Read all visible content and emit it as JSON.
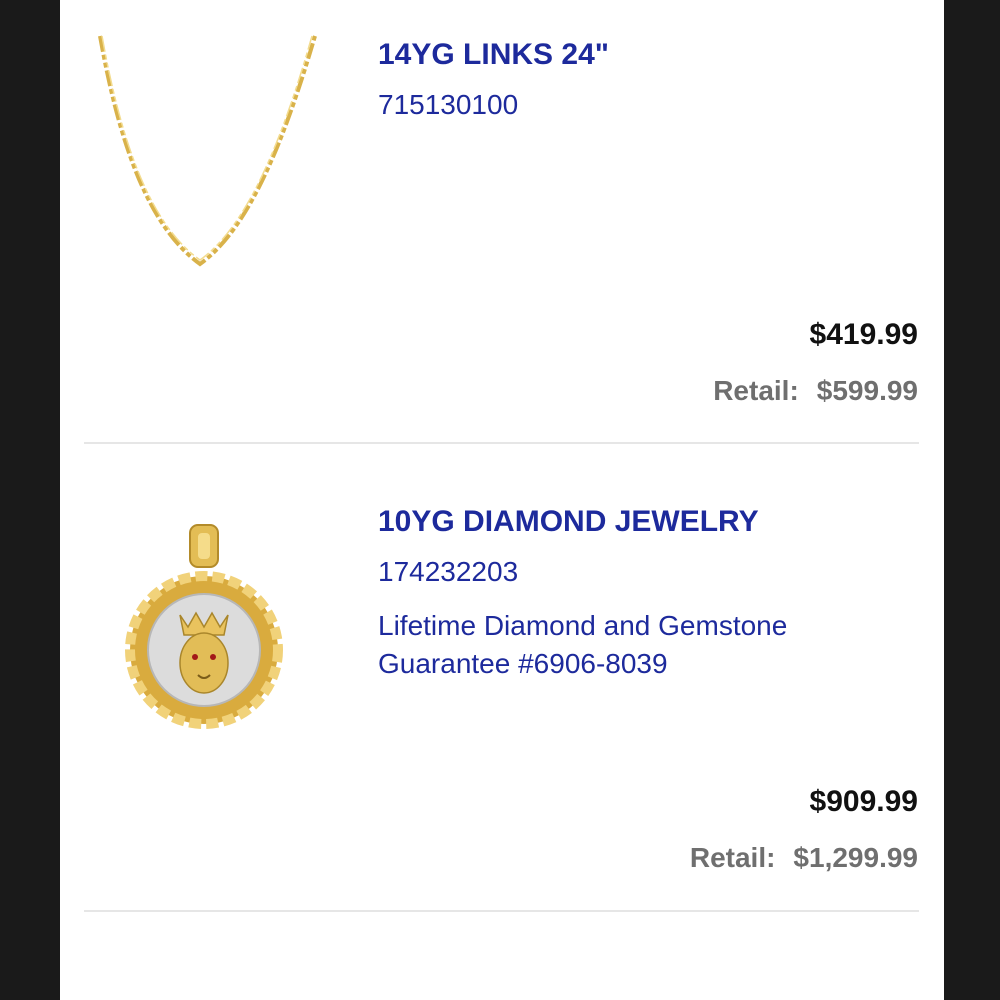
{
  "items": [
    {
      "name": "14YG LINKS 24\"",
      "sku": "715130100",
      "price": "$419.99",
      "retail_label": "Retail:",
      "retail_price": "$599.99",
      "image_icon": "gold-figaro-chain-icon"
    },
    {
      "name": "10YG DIAMOND JEWELRY",
      "sku": "174232203",
      "guarantee": "Lifetime Diamond and Gemstone Guarantee #6906-8039",
      "price": "$909.99",
      "retail_label": "Retail:",
      "retail_price": "$1,299.99",
      "image_icon": "lion-medallion-pendant-icon"
    }
  ],
  "colors": {
    "title": "#1d2a9c",
    "price": "#111111",
    "retail": "#6f6f6f",
    "gold": "#d9b24a",
    "frame": "#1a1a1a"
  }
}
